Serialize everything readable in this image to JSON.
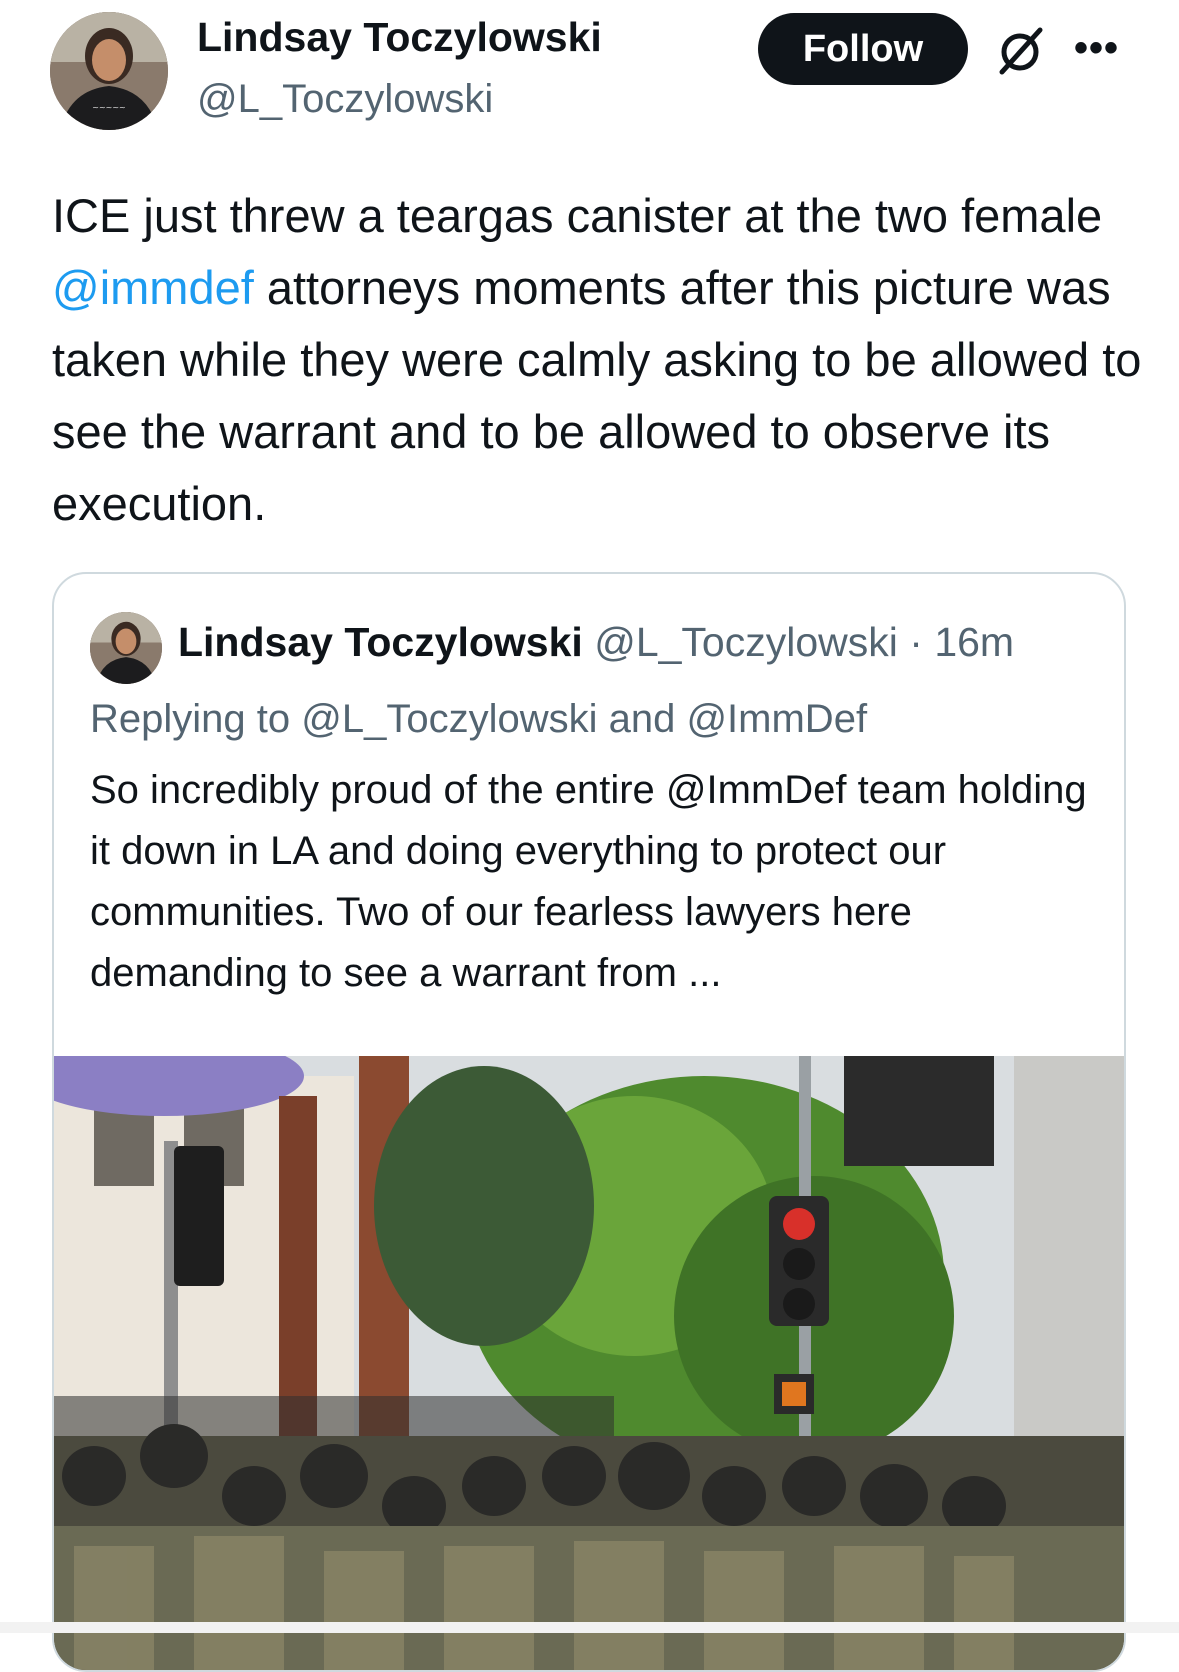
{
  "colors": {
    "text_primary": "#0f1419",
    "text_secondary": "#536471",
    "link": "#1d9bf0",
    "follow_bg": "#0f1419",
    "border": "#cfd9de"
  },
  "post": {
    "author_name": "Lindsay Toczylowski",
    "author_handle": "@L_Toczylowski",
    "follow_label": "Follow",
    "text_before_mention": "ICE just threw a teargas canister at the two female ",
    "mention": "@immdef",
    "text_after_mention": " attorneys moments after this picture was taken while they were calmly asking to be allowed to see the warrant and to be allowed to observe its execution."
  },
  "quote": {
    "author_name": "Lindsay Toczylowski",
    "author_handle": "@L_Toczylowski",
    "separator": "·",
    "time": "16m",
    "replying_to": "Replying to @L_Toczylowski and @ImmDef",
    "text": "So incredibly proud of the entire @ImmDef team holding it down in LA and doing everything to protect our communities. Two of our fearless lawyers here demanding to see a warrant from ..."
  },
  "icons": {
    "grok": "grok-icon",
    "more": "more-icon"
  }
}
